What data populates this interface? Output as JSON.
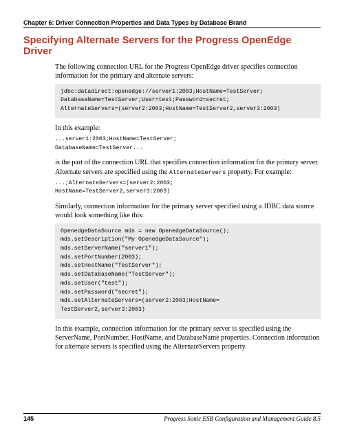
{
  "chapter": "Chapter 6: Driver Connection Properties and Data Types by Database Brand",
  "heading": "Specifying Alternate Servers for the Progress OpenEdge Driver",
  "p1": "The following connection URL for the Progress OpenEdge driver specifies connection information for the primary and alternate servers:",
  "code1": "jdbc:datadirect:openedge://server1:2003;HostName=TestServer;\nDatabaseName=TestServer;User=test;Password=secret;\nAlternateServers=(server2:2003;HostName=TestServer2,server3:2003)",
  "p2": "In this example:",
  "code2": "...server1:2003;HostName=TestServer;\nDatabaseName=TestServer...",
  "p3a": "is the part of the connection URL that specifies connection information for the primary server. Alternate servers are specified using the ",
  "p3code": "AlternateServers",
  "p3b": " property. For example:",
  "code3": "...;AlternateServers=(server2:2003;\nHostName=TestServer2,server3:2003)",
  "p4": "Similarly, connection information for the primary server specified using a JDBC data source would look something like this:",
  "code4": "OpenedgeDataSource mds = new OpenedgeDataSource();\nmds.setDescription(\"My OpenedgeDataSource\");\nmds.setServerName(\"server1\");\nmds.setPortNumber(2003);\nmds.setHostName(\"TestServer\");\nmds.setDatabaseName(\"TestServer\");\nmds.setUser(\"test\");\nmds.setPassword(\"secret\");\nmds.setAlternateServers=(server2:2003;HostName=\nTestServer2,server3:2003)",
  "p5": "In this example, connection information for the primary server is specified using the ServerName, PortNumber, HostName, and DatabaseName properties. Connection information for alternate servers is specified using the AlternateServers property.",
  "footer": {
    "page": "145",
    "title": "Progress Sonic ESB Configuration and Management Guide 8.5"
  }
}
